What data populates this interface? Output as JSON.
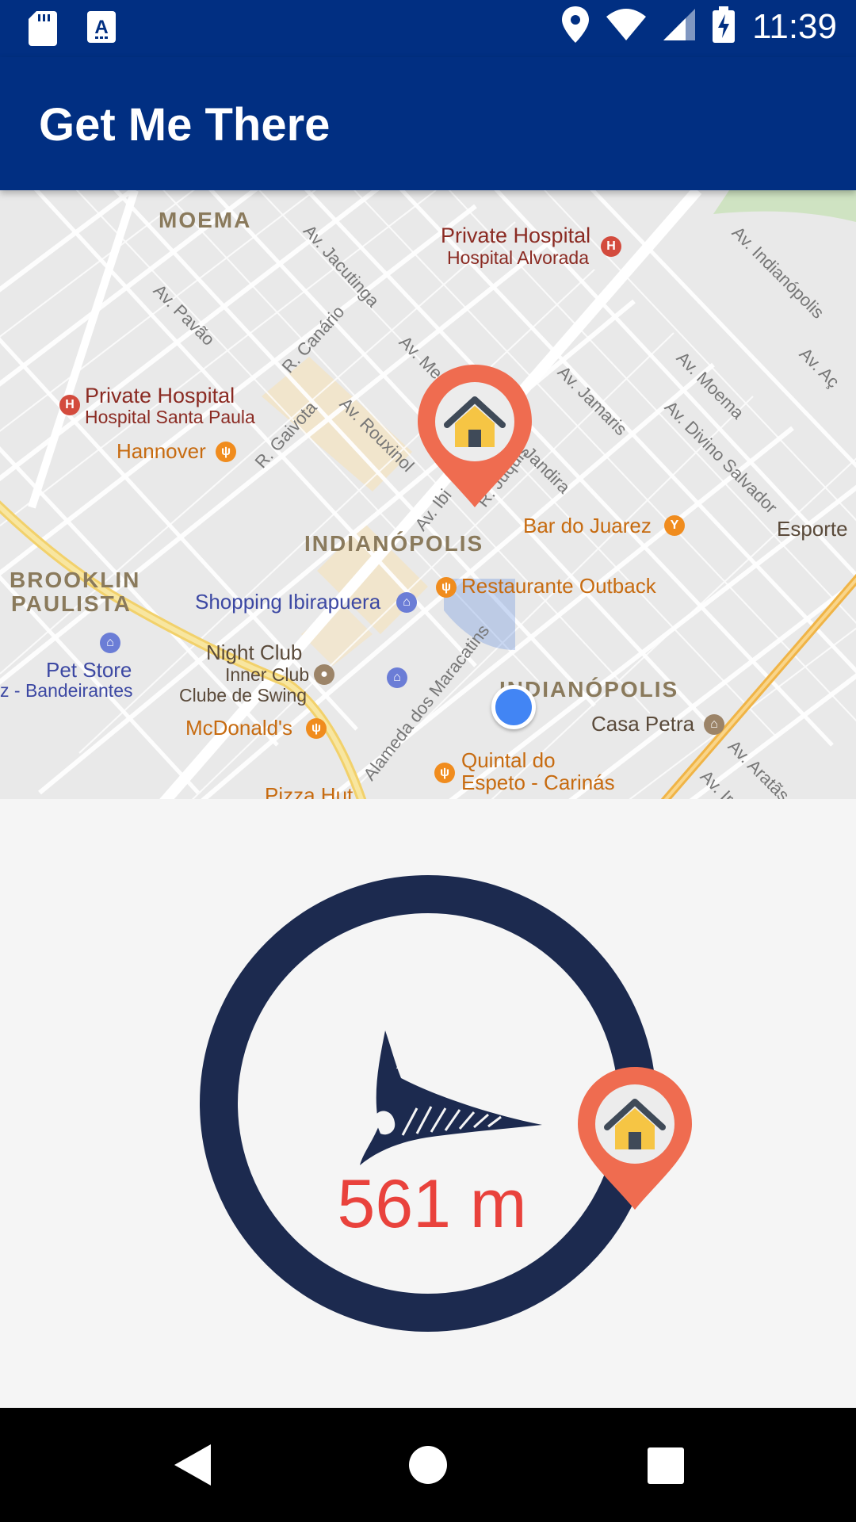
{
  "status_bar": {
    "time": "11:39",
    "left_icons": [
      "sd-card-icon",
      "keyboard-a-icon"
    ],
    "right_icons": [
      "location-icon",
      "wifi-icon",
      "signal-icon",
      "battery-charging-icon"
    ]
  },
  "app_bar": {
    "title": "Get Me There",
    "color": "#012f82"
  },
  "map": {
    "districts": [
      "MOEMA",
      "INDIANÓPOLIS",
      "BROOKLIN",
      "PAULISTA",
      "INDIANÓPOLIS"
    ],
    "streets": [
      "Av. Jacutinga",
      "Av. Pavão",
      "R. Canário",
      "R. Gaivota",
      "Av. Rouxinol",
      "Av. Me",
      "Av. Ibi",
      "R. Juquis",
      "Jandira",
      "Av. Jamaris",
      "Av. Moema",
      "Av. Divino Salvador",
      "Av. Indianópolis",
      "Av. Aç",
      "Alameda dos Maracatins",
      "Av. Aratãs",
      "Av. Ir"
    ],
    "places": {
      "hospital_alvorada_title": "Private Hospital",
      "hospital_alvorada_name": "Hospital Alvorada",
      "hospital_santa_paula_title": "Private Hospital",
      "hospital_santa_paula_name": "Hospital Santa Paula",
      "hannover": "Hannover",
      "bar_do_juarez": "Bar do Juarez",
      "esporte": "Esporte",
      "restaurante_outback": "Restaurante Outback",
      "shopping_ibirapuera": "Shopping Ibirapuera",
      "pet_store": "Pet Store",
      "bandeirantes": "z - Bandeirantes",
      "night_club_title": "Night Club",
      "night_club_name": "Inner Club",
      "clube_de_swing": "Clube de Swing",
      "mcdonalds": "McDonald's",
      "casa_petra": "Casa Petra",
      "quintal_line1": "Quintal do",
      "quintal_line2": "Espeto - Carinás",
      "pizza_hut": "Pizza Hut"
    },
    "home_marker_icon": "home-pin-icon",
    "current_location_icon": "current-location-dot"
  },
  "compass": {
    "distance": "561 m",
    "ring_color": "#1c2a4f",
    "distance_color": "#e9423c",
    "pointer_icon": "arrowhead-pointer-icon",
    "destination_icon": "home-pin-icon"
  },
  "nav_bar": {
    "buttons": [
      "back-icon",
      "home-circle-icon",
      "recents-square-icon"
    ]
  }
}
